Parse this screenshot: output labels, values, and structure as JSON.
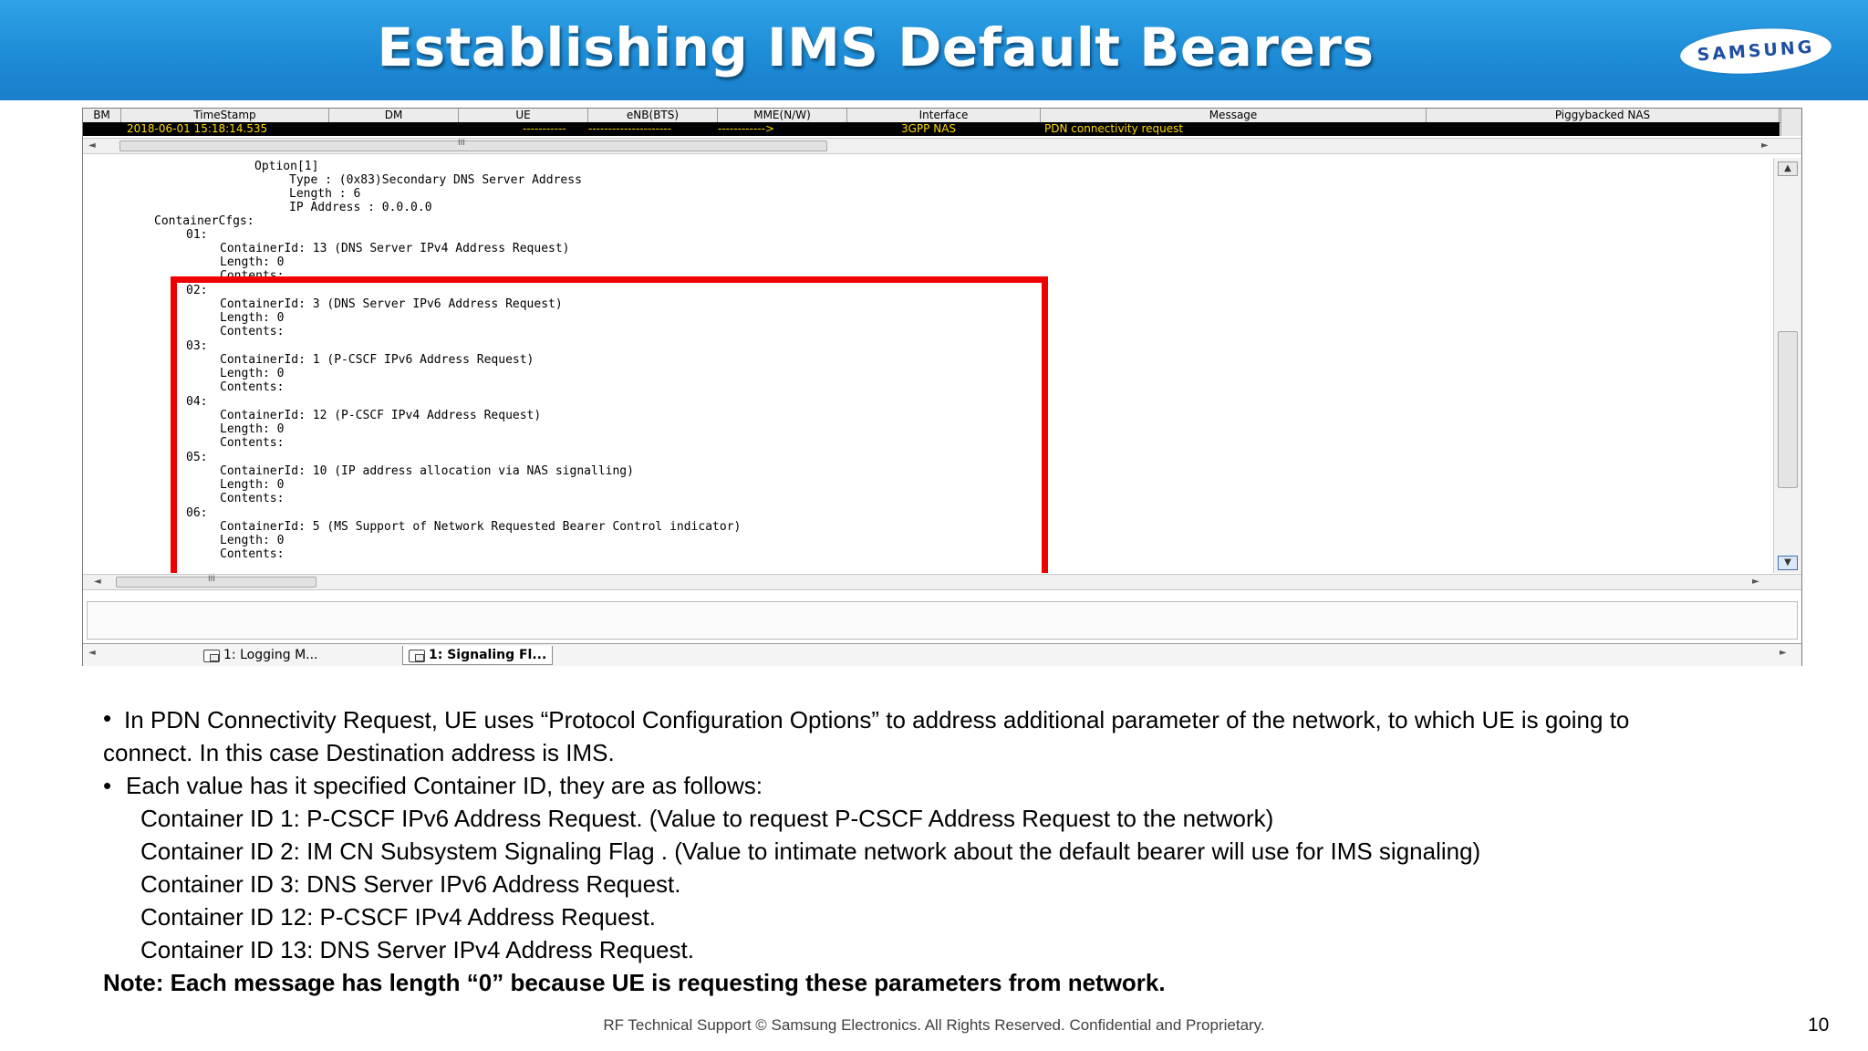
{
  "slide": {
    "title": "Establishing  IMS Default Bearers",
    "logo_text": "SAMSUNG",
    "page_number": "10",
    "footer": "RF Technical Support © Samsung Electronics. All Rights Reserved. Confidential and Proprietary."
  },
  "tool": {
    "columns": [
      "BM",
      "TimeStamp",
      "DM",
      "UE",
      "eNB(BTS)",
      "MME(N/W)",
      "Interface",
      "Message",
      "Piggybacked NAS"
    ],
    "selected_row": {
      "timestamp": "2018-06-01 15:18:14.535",
      "ue": "-----------",
      "enb": "---------------------",
      "mme": "------------>",
      "interface": "3GPP NAS",
      "message": "PDN connectivity request",
      "nas": ""
    },
    "scroll_mark": "III",
    "decode_lines": [
      "Option[1]",
      "Type : (0x83)Secondary DNS Server Address",
      "Length : 6",
      "IP Address : 0.0.0.0",
      "ContainerCfgs:",
      "01:",
      "ContainerId: 13 (DNS Server IPv4 Address Request)",
      "Length: 0",
      "Contents:",
      "02:",
      "ContainerId: 3 (DNS Server IPv6 Address Request)",
      "Length: 0",
      "Contents:",
      "03:",
      "ContainerId: 1 (P-CSCF IPv6 Address Request)",
      "Length: 0",
      "Contents:",
      "04:",
      "ContainerId: 12 (P-CSCF IPv4 Address Request)",
      "Length: 0",
      "Contents:",
      "05:",
      "ContainerId: 10 (IP address allocation via NAS signalling)",
      "Length: 0",
      "Contents:",
      "06:",
      "ContainerId: 5 (MS Support of Network Requested Bearer Control indicator)",
      "Length: 0",
      "Contents:"
    ],
    "tabs": [
      "1: Logging M...",
      "1: Signaling Fl..."
    ]
  },
  "text": {
    "b1_line1": "In PDN Connectivity Request, UE   uses “Protocol Configuration Options” to address additional parameter of the network, to which UE is going to",
    "b1_line2": "connect. In this case Destination address is IMS.",
    "b2": "Each value has it specified Container ID, they are as follows:",
    "ids": [
      "Container ID 1: P-CSCF IPv6 Address Request. (Value to request P-CSCF Address Request to the network)",
      "Container ID 2: IM CN Subsystem Signaling Flag . (Value to intimate network about the default bearer will use for IMS signaling)",
      "Container ID 3: DNS Server IPv6 Address Request.",
      "Container ID 12: P-CSCF IPv4 Address Request.",
      "Container ID 13: DNS Server IPv4 Address Request."
    ],
    "note": "Note: Each message has length “0” because UE is requesting  these  parameters from network."
  }
}
